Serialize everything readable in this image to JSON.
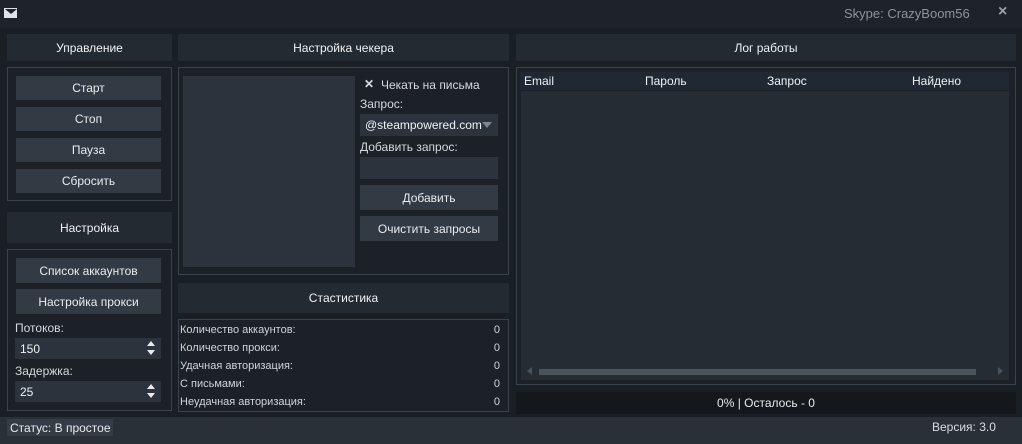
{
  "window": {
    "skype": "Skype: CrazyBoom56",
    "close": "×"
  },
  "control": {
    "title": "Управление",
    "buttons": [
      "Старт",
      "Стоп",
      "Пауза",
      "Сбросить"
    ]
  },
  "settings": {
    "title": "Настройка",
    "accounts_button": "Список аккаунтов",
    "proxy_button": "Настройка прокси",
    "threads_label": "Потоков:",
    "threads_value": "150",
    "delay_label": "Задержка:",
    "delay_value": "25"
  },
  "checker": {
    "title": "Настройка чекера",
    "check_mail_label": "Чекать на письма",
    "check_mark": "✕",
    "query_label": "Запрос:",
    "query_value": "@steampowered.com",
    "add_query_label": "Добавить запрос:",
    "add_query_value": "",
    "add_button": "Добавить",
    "clear_button": "Очистить запросы"
  },
  "stats": {
    "title": "Стaстистика",
    "rows": [
      {
        "label": "Количество аккаунтов:",
        "value": "0"
      },
      {
        "label": "Количество прокси:",
        "value": "0"
      },
      {
        "label": "Удачная авторизация:",
        "value": "0"
      },
      {
        "label": "С письмами:",
        "value": "0"
      },
      {
        "label": "Неудачная авторизация:",
        "value": "0"
      }
    ]
  },
  "log": {
    "title": "Лог работы",
    "columns": [
      "Email",
      "Пароль",
      "Запрос",
      "Найдено"
    ],
    "progress": "0% | Осталось - 0"
  },
  "status": {
    "text": "Статус: В простое",
    "version": "Версия: 3.0"
  },
  "colors": {
    "bg": "#1a1f26",
    "panel": "#242a32",
    "button": "#323a44",
    "header": "#1f2833"
  }
}
